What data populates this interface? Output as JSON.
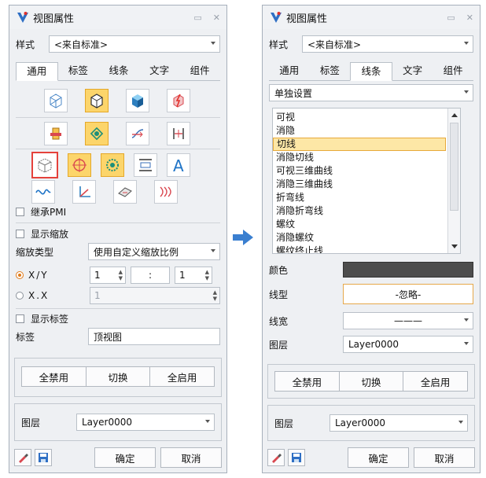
{
  "arrow_color": "#3a7fd0",
  "accent_colors": {
    "highlight": "#fcd56b",
    "selection_red": "#e5413b",
    "radio": "#e07a19",
    "swatch": "#4d4d4d"
  },
  "left": {
    "title": "视图属性",
    "style_label": "样式",
    "style_value": "<来自标准>",
    "tabs": [
      "通用",
      "标签",
      "线条",
      "文字",
      "组件"
    ],
    "active_tab": "通用",
    "icons_row1": [
      "view-cube-wire-icon",
      "view-cube-shaded-icon",
      "view-solid-icon",
      "view-explode-icon"
    ],
    "icons_row2": [
      "view-section-icon",
      "view-rotate-icon",
      "view-flow-icon",
      "view-dimension-icon"
    ],
    "icons_row3": [
      "view-box-icon",
      "view-target-icon",
      "view-gear-icon",
      "view-height-icon",
      "view-text-a-icon"
    ],
    "icons_row4": [
      "view-curve-icon",
      "view-axis-icon",
      "view-surface-icon",
      "view-hatch-icon"
    ],
    "inherit_pmi": "继承PMI",
    "show_scale": "显示缩放",
    "scale_type_label": "缩放类型",
    "scale_type_value": "使用自定义缩放比例",
    "xy_label": "X/Y",
    "xy_value1": "1",
    "xy_sep": ":",
    "xy_value2": "1",
    "xx_label": "X.X",
    "xx_value": "1",
    "show_label": "显示标签",
    "label_label": "标签",
    "label_value": "顶视图",
    "btn_disable_all": "全禁用",
    "btn_toggle": "切换",
    "btn_enable_all": "全启用",
    "layer_label": "图层",
    "layer_value": "Layer0000",
    "ok": "确定",
    "cancel": "取消"
  },
  "right": {
    "title": "视图属性",
    "style_label": "样式",
    "style_value": "<来自标准>",
    "tabs": [
      "通用",
      "标签",
      "线条",
      "文字",
      "组件"
    ],
    "active_tab": "线条",
    "setting_value": "单独设置",
    "line_items": [
      "可视",
      "消隐",
      "切线",
      "消隐切线",
      "可视三维曲线",
      "消隐三维曲线",
      "折弯线",
      "消隐折弯线",
      "螺纹",
      "消隐螺纹",
      "螺纹终止线"
    ],
    "selected_item": "切线",
    "color_label": "颜色",
    "linetype_label": "线型",
    "linetype_value": "-忽略-",
    "linewidth_label": "线宽",
    "linewidth_value": "———",
    "layer_label": "图层",
    "layer_value": "Layer0000",
    "btn_disable_all": "全禁用",
    "btn_toggle": "切换",
    "btn_enable_all": "全启用",
    "layer2_label": "图层",
    "layer2_value": "Layer0000",
    "ok": "确定",
    "cancel": "取消"
  }
}
